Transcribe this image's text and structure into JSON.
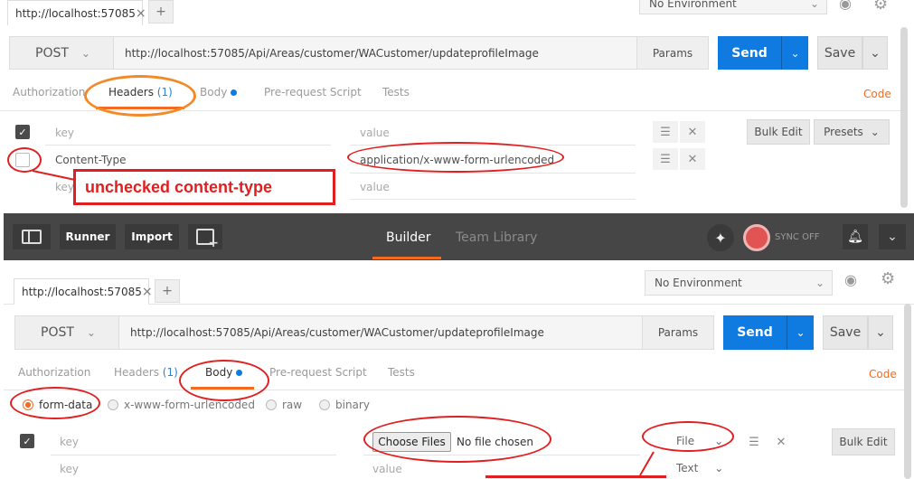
{
  "top": {
    "tab_url": "http://localhost:57085",
    "tab_close": "×",
    "tab_add": "+",
    "environment": "No Environment",
    "method": "POST",
    "url": "http://localhost:57085/Api/Areas/customer/WACustomer/updateprofileImage",
    "params": "Params",
    "send": "Send",
    "save": "Save",
    "subtabs": {
      "authorization": "Authorization",
      "headers": "Headers",
      "headers_count": "(1)",
      "body": "Body",
      "prescript": "Pre-request Script",
      "tests": "Tests",
      "code": "Code"
    },
    "rows": [
      {
        "key": "key",
        "value": "value",
        "checked": true
      },
      {
        "key": "Content-Type",
        "value": "application/x-www-form-urlencoded",
        "checked": false
      },
      {
        "key": "key",
        "value": "value",
        "checked": false
      }
    ],
    "bulk_edit": "Bulk Edit",
    "presets": "Presets",
    "annotation": "unchecked content-type"
  },
  "header": {
    "runner": "Runner",
    "import": "Import",
    "builder": "Builder",
    "team_library": "Team Library",
    "sync": "SYNC OFF"
  },
  "bottom": {
    "tab_url": "http://localhost:57085",
    "tab_close": "×",
    "tab_add": "+",
    "environment": "No Environment",
    "method": "POST",
    "url": "http://localhost:57085/Api/Areas/customer/WACustomer/updateprofileImage",
    "params": "Params",
    "send": "Send",
    "save": "Save",
    "subtabs": {
      "authorization": "Authorization",
      "headers": "Headers",
      "headers_count": "(1)",
      "body": "Body",
      "prescript": "Pre-request Script",
      "tests": "Tests",
      "code": "Code"
    },
    "body_modes": {
      "form_data": "form-data",
      "urlencoded": "x-www-form-urlencoded",
      "raw": "raw",
      "binary": "binary"
    },
    "row1": {
      "key": "key",
      "choose_files": "Choose Files",
      "no_file": "No file chosen",
      "type": "File"
    },
    "row2": {
      "key": "key",
      "value": "value",
      "type": "Text"
    },
    "bulk_edit": "Bulk Edit"
  }
}
